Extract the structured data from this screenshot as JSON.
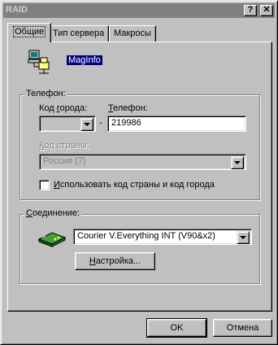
{
  "window": {
    "title": "RAID",
    "help_glyph": "?",
    "close_glyph": "✕"
  },
  "tabs": [
    {
      "label": "Общие",
      "active": true
    },
    {
      "label": "Тип сервера",
      "active": false
    },
    {
      "label": "Макросы",
      "active": false
    }
  ],
  "connection_name": "MagInfo",
  "phone_group": {
    "title": "Телефон:",
    "area_code_label_prefix": "Код ",
    "area_code_label_u": "г",
    "area_code_label_suffix": "орода:",
    "area_code_value": "",
    "dash": "-",
    "phone_label_prefix": "",
    "phone_label_u": "Т",
    "phone_label_suffix": "елефон:",
    "phone_value": "219986",
    "country_label_prefix": "",
    "country_label_u": "К",
    "country_label_suffix": "од страны:",
    "country_value": "Россия (7)",
    "use_codes_prefix": "",
    "use_codes_u": "И",
    "use_codes_suffix": "спользовать код страны и код города",
    "use_codes_checked": false
  },
  "connection_group": {
    "title_prefix": "",
    "title_u": "С",
    "title_suffix": "оединение:",
    "modem_value": "Courier V.Everything INT (V90&x2)",
    "setup_button_prefix": "",
    "setup_button_u": "Н",
    "setup_button_suffix": "астройка..."
  },
  "footer": {
    "ok_label": "OK",
    "cancel_label": "Отмена"
  },
  "colors": {
    "face": "#c0c0c0",
    "selection": "#000080",
    "titlebar_inactive": "#808080"
  }
}
